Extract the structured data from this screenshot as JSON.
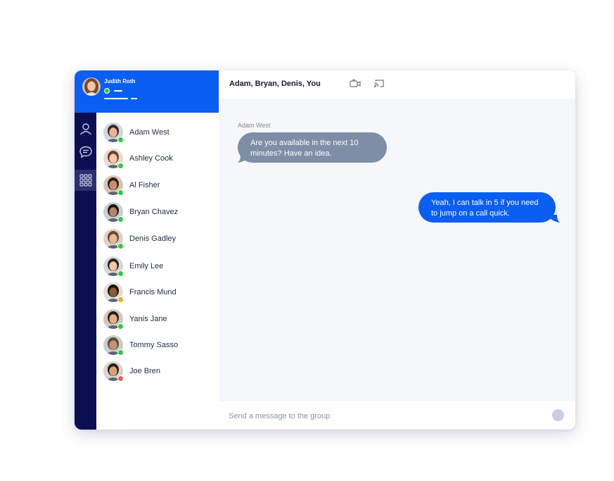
{
  "user": {
    "name": "Judith Roth",
    "status_color": "#2ecc40"
  },
  "nav": {
    "items": [
      {
        "icon": "person-icon"
      },
      {
        "icon": "chat-bubble-icon"
      },
      {
        "icon": "grid-apps-icon",
        "active": true
      }
    ]
  },
  "contacts": [
    {
      "name": "Adam West",
      "status": "online"
    },
    {
      "name": "Ashley Cook",
      "status": "online"
    },
    {
      "name": "Al Fisher",
      "status": "online"
    },
    {
      "name": "Bryan Chavez",
      "status": "online"
    },
    {
      "name": "Denis Gadley",
      "status": "online"
    },
    {
      "name": "Emily Lee",
      "status": "online"
    },
    {
      "name": "Francis Mund",
      "status": "away"
    },
    {
      "name": "Yanis Jane",
      "status": "online"
    },
    {
      "name": "Tommy Sasso",
      "status": "online"
    },
    {
      "name": "Joe Bren",
      "status": "busy"
    }
  ],
  "status_colors": {
    "online": "#2ecc40",
    "away": "#f5a623",
    "busy": "#f25c5c"
  },
  "chat": {
    "title": "Adam, Bryan, Denis, You",
    "header_icons": [
      "video-call-icon",
      "cast-screen-icon"
    ],
    "messages": [
      {
        "sender": "Adam West",
        "text": "Are you available in the next 10 minutes? Have an idea.",
        "direction": "incoming"
      },
      {
        "sender": "",
        "text": "Yeah, I can talk in 5 if you need to jump on a call quick.",
        "direction": "outgoing"
      }
    ]
  },
  "composer": {
    "placeholder": "Send a message to the group",
    "value": ""
  },
  "colors": {
    "brand_blue": "#0a5ef2",
    "rail_navy": "#0b0e52",
    "incoming_bubble": "#7d8ea6",
    "chat_bg": "#f5f7fa"
  }
}
